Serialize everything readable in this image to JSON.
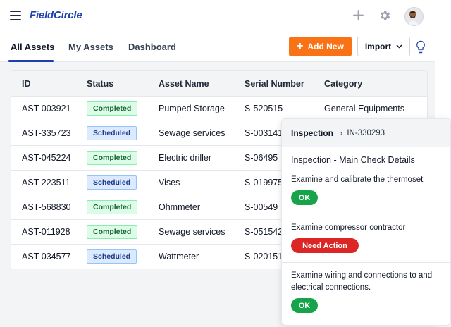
{
  "app": {
    "logo": "FieldCircle"
  },
  "icons": {
    "menu": "hamburger-icon",
    "add": "plus-icon",
    "settings": "gear-icon",
    "avatar": "user-avatar",
    "idea": "lightbulb-icon"
  },
  "colors": {
    "brand": "#1e40af",
    "accent": "#f97316",
    "ok": "#16a34a",
    "need_action": "#dc2626"
  },
  "tabs": [
    {
      "label": "All Assets",
      "active": true
    },
    {
      "label": "My Assets",
      "active": false
    },
    {
      "label": "Dashboard",
      "active": false
    }
  ],
  "actions": {
    "add_new": "Add New",
    "import": "Import"
  },
  "table": {
    "headers": [
      "ID",
      "Status",
      "Asset Name",
      "Serial Number",
      "Category"
    ],
    "rows": [
      {
        "id": "AST-003921",
        "status": "Completed",
        "name": "Pumped Storage",
        "serial": "S-520515",
        "category": "General Equipments"
      },
      {
        "id": "AST-335723",
        "status": "Scheduled",
        "name": "Sewage services",
        "serial": "S-003141",
        "category": ""
      },
      {
        "id": "AST-045224",
        "status": "Completed",
        "name": "Electric driller",
        "serial": "S-06495",
        "category": ""
      },
      {
        "id": "AST-223511",
        "status": "Scheduled",
        "name": "Vises",
        "serial": "S-019975",
        "category": ""
      },
      {
        "id": "AST-568830",
        "status": "Completed",
        "name": "Ohmmeter",
        "serial": "S-00549",
        "category": ""
      },
      {
        "id": "AST-011928",
        "status": "Completed",
        "name": "Sewage services",
        "serial": "S-051542",
        "category": ""
      },
      {
        "id": "AST-034577",
        "status": "Scheduled",
        "name": "Wattmeter",
        "serial": "S-020151",
        "category": ""
      }
    ]
  },
  "inspection": {
    "title": "Inspection",
    "ref": "IN-330293",
    "subtitle": "Inspection - Main Check Details",
    "checks": [
      {
        "label": "Examine and calibrate the thermoset",
        "result": "OK",
        "type": "ok"
      },
      {
        "label": "Examine compressor contractor",
        "result": "Need Action",
        "type": "need"
      },
      {
        "label": "Examine wiring and connections to and electrical connections.",
        "result": "OK",
        "type": "ok"
      }
    ]
  }
}
